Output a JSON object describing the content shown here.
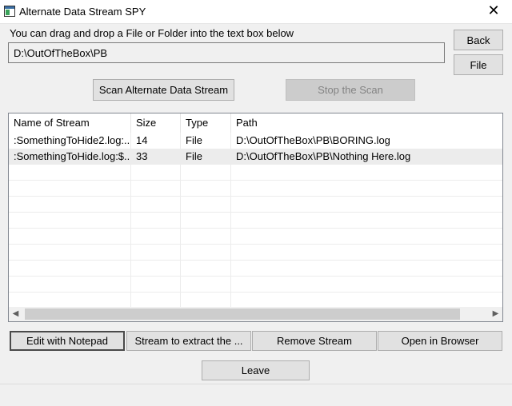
{
  "window": {
    "title": "Alternate Data Stream SPY",
    "close_glyph": "✕"
  },
  "instruction": "You can drag and drop a File or Folder into the text box below",
  "path_input": {
    "value": "D:\\OutOfTheBox\\PB"
  },
  "buttons": {
    "back": "Back",
    "file": "File",
    "scan": "Scan Alternate Data Stream",
    "stop": "Stop the Scan",
    "edit_notepad": "Edit with Notepad",
    "stream_extract": "Stream to extract the ...",
    "remove_stream": "Remove Stream",
    "open_browser": "Open in Browser",
    "leave": "Leave"
  },
  "table": {
    "columns": [
      "Name of Stream",
      "Size",
      "Type",
      "Path"
    ],
    "rows": [
      [
        ":SomethingToHide2.log:...",
        "14",
        "File",
        "D:\\OutOfTheBox\\PB\\BORING.log"
      ],
      [
        ":SomethingToHide.log:$...",
        "33",
        "File",
        "D:\\OutOfTheBox\\PB\\Nothing Here.log"
      ]
    ]
  },
  "scrollbar": {
    "left_arrow": "◀",
    "right_arrow": "▶"
  }
}
